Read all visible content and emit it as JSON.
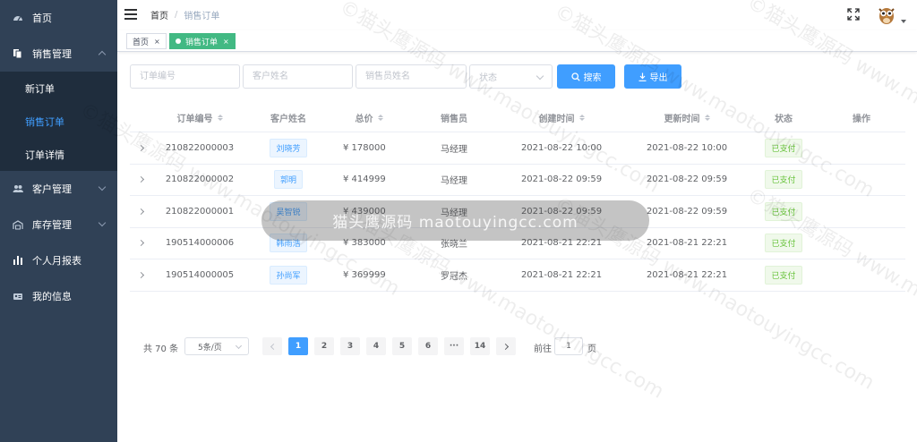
{
  "sidebar": {
    "items": [
      {
        "label": "首页",
        "icon": "dashboard-icon"
      },
      {
        "label": "销售管理",
        "icon": "document-icon",
        "expanded": true,
        "children": [
          {
            "label": "新订单",
            "active": false
          },
          {
            "label": "销售订单",
            "active": true
          },
          {
            "label": "订单详情",
            "active": false
          }
        ]
      },
      {
        "label": "客户管理",
        "icon": "users-icon"
      },
      {
        "label": "库存管理",
        "icon": "warehouse-icon"
      },
      {
        "label": "个人月报表",
        "icon": "bar-chart-icon"
      },
      {
        "label": "我的信息",
        "icon": "id-card-icon"
      }
    ]
  },
  "header": {
    "breadcrumb": {
      "home": "首页",
      "separator": "/",
      "current": "销售订单"
    }
  },
  "tags": [
    {
      "label": "首页",
      "close": "×",
      "active": false
    },
    {
      "label": "销售订单",
      "close": "×",
      "active": true
    }
  ],
  "filters": {
    "order_no_placeholder": "订单编号",
    "customer_placeholder": "客户姓名",
    "salesperson_placeholder": "销售员姓名",
    "status_placeholder": "状态",
    "search_label": "搜索",
    "export_label": "导出"
  },
  "table": {
    "columns": [
      "订单编号",
      "客户姓名",
      "总价",
      "销售员",
      "创建时间",
      "更新时间",
      "状态",
      "操作"
    ],
    "rows": [
      {
        "order_no": "210822000003",
        "customer": "刘晓芳",
        "price": "¥ 178000",
        "salesperson": "马经理",
        "created": "2021-08-22 10:00",
        "updated": "2021-08-22 10:00",
        "status": "已支付"
      },
      {
        "order_no": "210822000002",
        "customer": "郭明",
        "price": "¥ 414999",
        "salesperson": "马经理",
        "created": "2021-08-22 09:59",
        "updated": "2021-08-22 09:59",
        "status": "已支付"
      },
      {
        "order_no": "210822000001",
        "customer": "吴智锐",
        "price": "¥ 439000",
        "salesperson": "马经理",
        "created": "2021-08-22 09:59",
        "updated": "2021-08-22 09:59",
        "status": "已支付"
      },
      {
        "order_no": "190514000006",
        "customer": "韩雨浩",
        "price": "¥ 383000",
        "salesperson": "张晓兰",
        "created": "2021-08-21 22:21",
        "updated": "2021-08-21 22:21",
        "status": "已支付"
      },
      {
        "order_no": "190514000005",
        "customer": "孙尚军",
        "price": "¥ 369999",
        "salesperson": "罗冠杰",
        "created": "2021-08-21 22:21",
        "updated": "2021-08-21 22:21",
        "status": "已支付"
      }
    ]
  },
  "pagination": {
    "total": "共 70 条",
    "page_size": "5条/页",
    "pages": [
      "1",
      "2",
      "3",
      "4",
      "5",
      "6",
      "···",
      "14"
    ],
    "current": "1",
    "goto_label": "前往",
    "goto_value": "1",
    "goto_unit": "页"
  },
  "toast": "猫头鹰源码 maotouyingcc.com",
  "watermark": "©猫头鹰源码 www.maotouyingcc.com",
  "colors": {
    "sidebar_bg": "#304156",
    "submenu_bg": "#1f2d3d",
    "primary": "#409eff",
    "tag_active": "#42b983",
    "success": "#67c23a"
  }
}
